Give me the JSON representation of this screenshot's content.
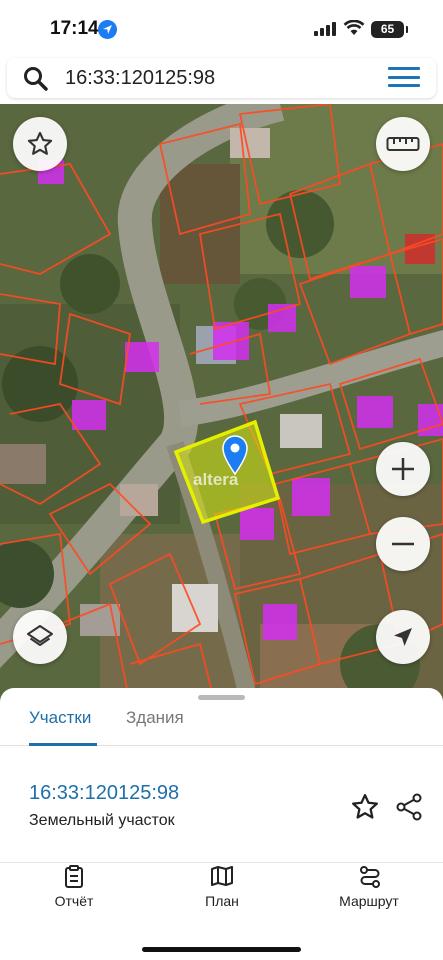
{
  "status_bar": {
    "time": "17:14",
    "battery": "65"
  },
  "search": {
    "query": "16:33:120125:98"
  },
  "map": {
    "watermark": "altera",
    "parcel_color": "#e4f000",
    "pin_color": "#1c7cf2"
  },
  "sheet": {
    "tabs": [
      {
        "label": "Участки",
        "active": true
      },
      {
        "label": "Здания",
        "active": false
      }
    ],
    "result": {
      "id": "16:33:120125:98",
      "type": "Земельный участок"
    }
  },
  "bottom_nav": [
    {
      "label": "Отчёт",
      "icon": "report-icon"
    },
    {
      "label": "План",
      "icon": "map-icon"
    },
    {
      "label": "Маршрут",
      "icon": "route-icon"
    }
  ],
  "colors": {
    "accent": "#1f6fa8",
    "menu": "#1d72b8"
  }
}
